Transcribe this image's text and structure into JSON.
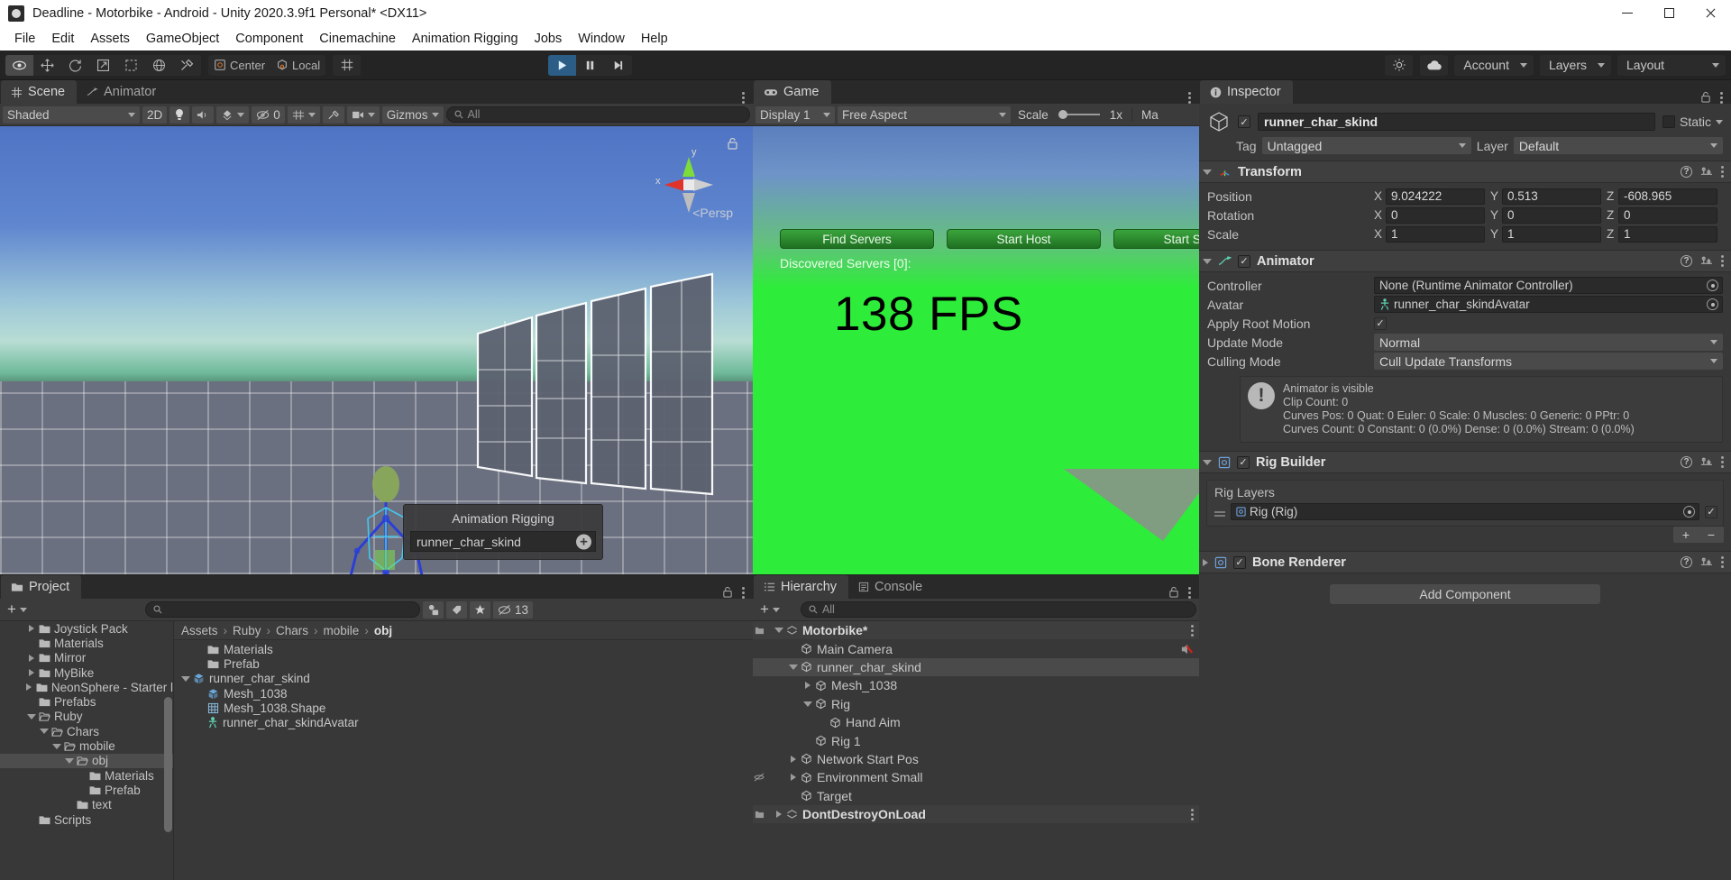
{
  "window": {
    "title": "Deadline - Motorbike - Android - Unity 2020.3.9f1 Personal* <DX11>",
    "minimize": "Minimize",
    "maximize": "Maximize",
    "close": "Close"
  },
  "menubar": {
    "items": [
      "File",
      "Edit",
      "Assets",
      "GameObject",
      "Component",
      "Cinemachine",
      "Animation Rigging",
      "Jobs",
      "Window",
      "Help"
    ]
  },
  "toolbar": {
    "tools": [
      "hand-tool",
      "move-tool",
      "rotate-tool",
      "scale-tool",
      "rect-tool",
      "transform-tool",
      "custom-tool"
    ],
    "pivot_mode": "Center",
    "pivot_rotation": "Local",
    "play": "Play",
    "pause": "Pause",
    "step": "Step",
    "account": "Account",
    "layers": "Layers",
    "layout": "Layout"
  },
  "scene_panel": {
    "tabs": [
      {
        "label": "Scene",
        "icon": "grid-icon",
        "selected": true
      },
      {
        "label": "Animator",
        "icon": "animator-icon",
        "selected": false
      }
    ],
    "draw_mode": "Shaded",
    "two_d": "2D",
    "effects_count": "0",
    "gizmos": "Gizmos",
    "search_placeholder": "All",
    "persp_label": "Persp",
    "gizmo_axes": [
      "x",
      "y"
    ],
    "overlay": {
      "title": "Animation Rigging",
      "value": "runner_char_skind",
      "add": "+"
    }
  },
  "game_panel": {
    "tab": "Game",
    "display": "Display 1",
    "aspect": "Free Aspect",
    "scale_label": "Scale",
    "scale_value": "1x",
    "maximize_label": "Ma",
    "buttons": [
      "Find Servers",
      "Start Host",
      "Start Serv"
    ],
    "discovered": "Discovered Servers [0]:",
    "fps": "138 FPS"
  },
  "hierarchy_panel": {
    "tabs": [
      {
        "label": "Hierarchy",
        "selected": true
      },
      {
        "label": "Console",
        "selected": false
      }
    ],
    "create_label": "+",
    "search_placeholder": "All",
    "rows": [
      {
        "label": "Motorbike*",
        "depth": 0,
        "arrow": "open",
        "icon": "scene-icon",
        "type": "scene",
        "selected": false,
        "kebab": true
      },
      {
        "label": "Main Camera",
        "depth": 1,
        "arrow": "none",
        "icon": "gameobject-icon",
        "type": "go",
        "selected": false,
        "badge": "audio-mute-icon"
      },
      {
        "label": "runner_char_skind",
        "depth": 1,
        "arrow": "open",
        "icon": "gameobject-icon",
        "type": "go",
        "selected": true
      },
      {
        "label": "Mesh_1038",
        "depth": 2,
        "arrow": "closed",
        "icon": "gameobject-icon",
        "type": "go",
        "selected": false
      },
      {
        "label": "Rig",
        "depth": 2,
        "arrow": "open",
        "icon": "gameobject-icon",
        "type": "go",
        "selected": false
      },
      {
        "label": "Hand Aim",
        "depth": 3,
        "arrow": "none",
        "icon": "gameobject-icon",
        "type": "go",
        "selected": false
      },
      {
        "label": "Rig 1",
        "depth": 2,
        "arrow": "none",
        "icon": "gameobject-icon",
        "type": "go",
        "selected": false
      },
      {
        "label": "Network Start Pos",
        "depth": 1,
        "arrow": "closed",
        "icon": "gameobject-icon",
        "type": "go",
        "selected": false
      },
      {
        "label": "Environment Small",
        "depth": 1,
        "arrow": "closed",
        "icon": "gameobject-icon",
        "type": "go",
        "selected": false,
        "left_icon": "hidden-icon"
      },
      {
        "label": "Target",
        "depth": 1,
        "arrow": "none",
        "icon": "gameobject-icon",
        "type": "go",
        "selected": false
      },
      {
        "label": "DontDestroyOnLoad",
        "depth": 0,
        "arrow": "closed",
        "icon": "scene-icon",
        "type": "scene",
        "selected": false,
        "kebab": true
      }
    ]
  },
  "project_panel": {
    "tab": "Project",
    "create_label": "+",
    "search_placeholder": "",
    "hidden_count": "13",
    "breadcrumb": [
      "Assets",
      "Ruby",
      "Chars",
      "mobile",
      "obj"
    ],
    "tree": [
      {
        "label": "Joystick Pack",
        "depth": 2,
        "arrow": "closed",
        "icon": "folder-icon",
        "selected": false
      },
      {
        "label": "Materials",
        "depth": 2,
        "arrow": "none",
        "icon": "folder-icon",
        "selected": false
      },
      {
        "label": "Mirror",
        "depth": 2,
        "arrow": "closed",
        "icon": "folder-icon",
        "selected": false
      },
      {
        "label": "MyBike",
        "depth": 2,
        "arrow": "closed",
        "icon": "folder-icon",
        "selected": false
      },
      {
        "label": "NeonSphere - Starter l",
        "depth": 2,
        "arrow": "closed",
        "icon": "folder-icon",
        "selected": false
      },
      {
        "label": "Prefabs",
        "depth": 2,
        "arrow": "none",
        "icon": "folder-icon",
        "selected": false
      },
      {
        "label": "Ruby",
        "depth": 2,
        "arrow": "open",
        "icon": "folder-open-icon",
        "selected": false
      },
      {
        "label": "Chars",
        "depth": 3,
        "arrow": "open",
        "icon": "folder-open-icon",
        "selected": false
      },
      {
        "label": "mobile",
        "depth": 4,
        "arrow": "open",
        "icon": "folder-open-icon",
        "selected": false
      },
      {
        "label": "obj",
        "depth": 5,
        "arrow": "open",
        "icon": "folder-open-icon",
        "selected": true
      },
      {
        "label": "Materials",
        "depth": 6,
        "arrow": "none",
        "icon": "folder-icon",
        "selected": false
      },
      {
        "label": "Prefab",
        "depth": 6,
        "arrow": "none",
        "icon": "folder-icon",
        "selected": false
      },
      {
        "label": "text",
        "depth": 5,
        "arrow": "none",
        "icon": "folder-icon",
        "selected": false
      },
      {
        "label": "Scripts",
        "depth": 2,
        "arrow": "none",
        "icon": "folder-icon",
        "selected": false
      }
    ],
    "assets": [
      {
        "label": "Materials",
        "depth": 1,
        "arrow": "none",
        "icon": "folder-icon"
      },
      {
        "label": "Prefab",
        "depth": 1,
        "arrow": "none",
        "icon": "folder-icon"
      },
      {
        "label": "runner_char_skind",
        "depth": 0,
        "arrow": "open",
        "icon": "model-icon"
      },
      {
        "label": "Mesh_1038",
        "depth": 1,
        "arrow": "none",
        "icon": "model-icon"
      },
      {
        "label": "Mesh_1038.Shape",
        "depth": 1,
        "arrow": "none",
        "icon": "mesh-icon"
      },
      {
        "label": "runner_char_skindAvatar",
        "depth": 1,
        "arrow": "none",
        "icon": "avatar-icon"
      }
    ]
  },
  "inspector": {
    "tab": "Inspector",
    "object_name": "runner_char_skind",
    "enabled": true,
    "static_label": "Static",
    "tag_label": "Tag",
    "tag_value": "Untagged",
    "layer_label": "Layer",
    "layer_value": "Default",
    "transform": {
      "title": "Transform",
      "rows": [
        {
          "label": "Position",
          "x": "9.024222",
          "y": "0.513",
          "z": "-608.965"
        },
        {
          "label": "Rotation",
          "x": "0",
          "y": "0",
          "z": "0"
        },
        {
          "label": "Scale",
          "x": "1",
          "y": "1",
          "z": "1"
        }
      ],
      "axes": [
        "X",
        "Y",
        "Z"
      ]
    },
    "animator": {
      "title": "Animator",
      "enabled": true,
      "controller_label": "Controller",
      "controller_value": "None (Runtime Animator Controller)",
      "avatar_label": "Avatar",
      "avatar_value": "runner_char_skindAvatar",
      "root_motion_label": "Apply Root Motion",
      "root_motion": true,
      "update_mode_label": "Update Mode",
      "update_mode_value": "Normal",
      "culling_mode_label": "Culling Mode",
      "culling_mode_value": "Cull Update Transforms",
      "info": [
        "Animator is visible",
        "Clip Count: 0",
        "Curves Pos: 0 Quat: 0 Euler: 0 Scale: 0 Muscles: 0 Generic: 0 PPtr: 0",
        "Curves Count: 0 Constant: 0 (0.0%) Dense: 0 (0.0%) Stream: 0 (0.0%)"
      ]
    },
    "rig_builder": {
      "title": "Rig Builder",
      "enabled": true,
      "layers_label": "Rig Layers",
      "layer_value": "Rig (Rig)",
      "layer_enabled": true,
      "add": "+",
      "remove": "−"
    },
    "bone_renderer": {
      "title": "Bone Renderer",
      "enabled": true
    },
    "add_component": "Add Component"
  },
  "colors": {
    "accent_blue": "#2c5d87",
    "panel_bg": "#383838",
    "toolbar_bg": "#242424",
    "game_green": "#2eec3a"
  }
}
